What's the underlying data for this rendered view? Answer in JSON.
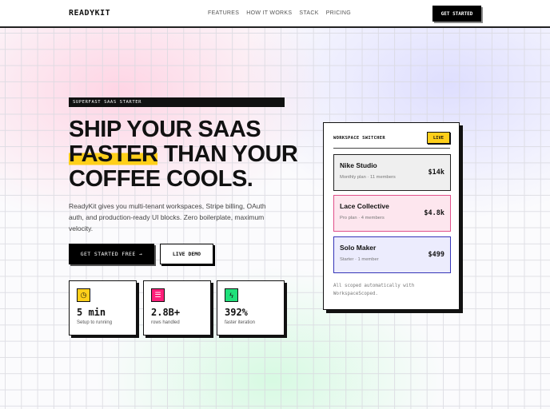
{
  "header": {
    "logo": "READYKIT",
    "nav": [
      "FEATURES",
      "HOW IT WORKS",
      "STACK",
      "PRICING"
    ],
    "cta": "GET STARTED"
  },
  "hero": {
    "badge": "SUPERFAST SAAS STARTER",
    "title_line1": "SHIP YOUR SAAS",
    "title_highlight": "FASTER",
    "title_line2_rest": " THAN YOUR",
    "title_line3": "COFFEE COOLS.",
    "description": "ReadyKit gives you multi-tenant workspaces, Stripe billing, OAuth auth, and production-ready UI blocks. Zero boilerplate, maximum velocity.",
    "primary_button": "GET STARTED FREE →",
    "secondary_button": "LIVE DEMO"
  },
  "stats": [
    {
      "icon": "clock-icon",
      "value": "5 min",
      "label": "Setup to running",
      "color": "#ffcf1a"
    },
    {
      "icon": "database-icon",
      "value": "2.8B+",
      "label": "rows handled",
      "color": "#ff1f7a"
    },
    {
      "icon": "bolt-icon",
      "value": "392%",
      "label": "faster iteration",
      "color": "#1fe07a"
    }
  ],
  "switcher": {
    "title": "WORKSPACE SWITCHER",
    "badge": "LIVE",
    "workspaces": [
      {
        "name": "Nike Studio",
        "meta": "Monthly plan · 11 members",
        "price": "$14k",
        "bg": "#efefef",
        "border": "#222"
      },
      {
        "name": "Lace Collective",
        "meta": "Pro plan · 4 members",
        "price": "$4.8k",
        "bg": "#fde6ee",
        "border": "#e0508a"
      },
      {
        "name": "Solo Maker",
        "meta": "Starter · 1 member",
        "price": "$499",
        "bg": "#ececfd",
        "border": "#3535b8"
      }
    ],
    "footer": "All scoped automatically with WorkspaceScoped."
  }
}
